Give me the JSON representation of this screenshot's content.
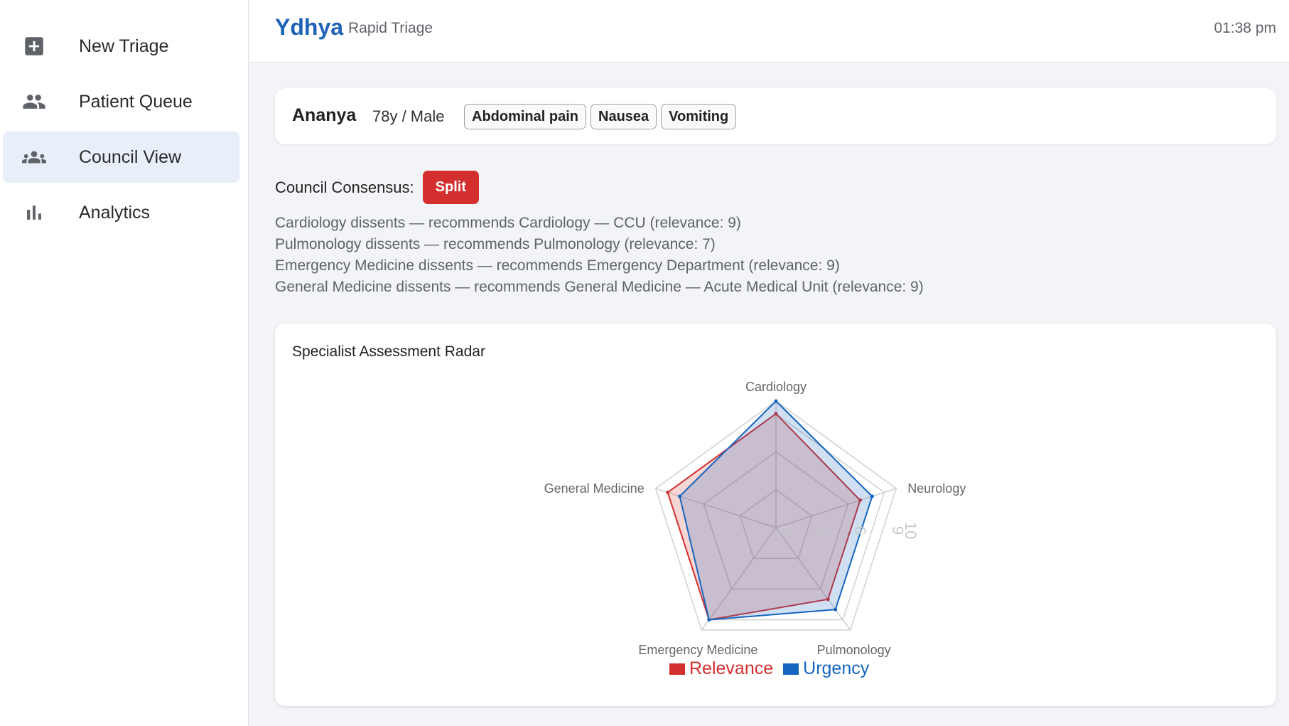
{
  "sidebar": {
    "items": [
      {
        "label": "New Triage",
        "icon": "plus-box-icon",
        "active": false
      },
      {
        "label": "Patient Queue",
        "icon": "people-icon",
        "active": false
      },
      {
        "label": "Council View",
        "icon": "groups-icon",
        "active": true
      },
      {
        "label": "Analytics",
        "icon": "bar-chart-icon",
        "active": false
      }
    ]
  },
  "header": {
    "brand": "Ydhya",
    "subtitle": "Rapid Triage",
    "time": "01:38 pm"
  },
  "patient": {
    "name": "Ananya",
    "meta": "78y / Male",
    "symptoms": [
      "Abdominal pain",
      "Nausea",
      "Vomiting"
    ]
  },
  "consensus": {
    "label": "Council Consensus:",
    "status": "Split",
    "status_color": "#d32f2f"
  },
  "dissents": [
    "Cardiology dissents — recommends Cardiology — CCU (relevance: 9)",
    "Pulmonology dissents — recommends Pulmonology (relevance: 7)",
    "Emergency Medicine dissents — recommends Emergency Department (relevance: 9)",
    "General Medicine dissents — recommends General Medicine — Acute Medical Unit (relevance: 9)"
  ],
  "radar": {
    "title": "Specialist Assessment Radar"
  },
  "chart_data": {
    "type": "radar",
    "categories": [
      "Cardiology",
      "Neurology",
      "Pulmonology",
      "Emergency Medicine",
      "General Medicine"
    ],
    "rlim": [
      0,
      10
    ],
    "ticks": [
      "0",
      "3",
      "6",
      "9",
      "10"
    ],
    "series": [
      {
        "name": "Relevance",
        "color": "#d32f2f",
        "values": [
          9,
          7,
          7,
          9,
          9
        ]
      },
      {
        "name": "Urgency",
        "color": "#1565c0",
        "values": [
          10,
          8,
          8,
          9,
          8
        ]
      }
    ],
    "legend": "bottom-center"
  }
}
